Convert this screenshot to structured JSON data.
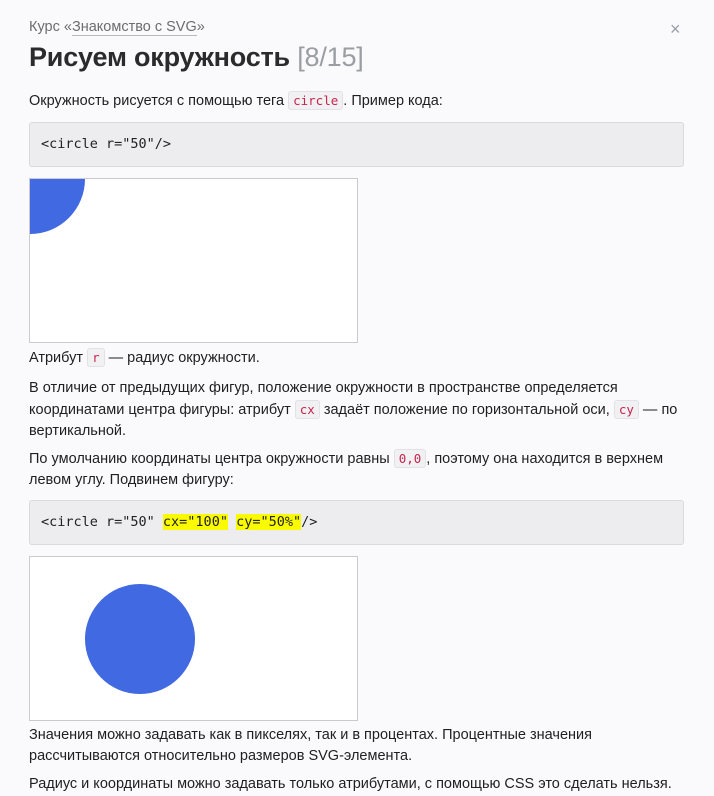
{
  "breadcrumb": {
    "prefix": "Курс «",
    "course_link": "Знакомство с SVG",
    "suffix": "»"
  },
  "close_label": "×",
  "title": {
    "text": "Рисуем окружность",
    "counter": "[8/15]"
  },
  "intro": {
    "before": "Окружность рисуется с помощью тега ",
    "tag": "circle",
    "after": ". Пример кода:"
  },
  "code1": "<circle r=\"50\"/>",
  "attr_r": {
    "before": "Атрибут ",
    "code": "r",
    "after": " — радиус окружности."
  },
  "position_para": {
    "part1": "В отличие от предыдущих фигур, положение окружности в пространстве определяется координатами центра фигуры: атрибут ",
    "code_cx": "cx",
    "part2": " задаёт положение по горизонтальной оси, ",
    "code_cy": "cy",
    "part3": " — по вертикальной."
  },
  "default_para": {
    "before": "По умолчанию координаты центра окружности равны ",
    "code": "0,0",
    "after": ", поэтому она находится в верхнем левом углу. Подвинем фигуру:"
  },
  "code2": {
    "start": "<circle r=\"50\" ",
    "cx": "cx=\"100\"",
    "space": " ",
    "cy": "cy=\"50%\"",
    "end": "/>"
  },
  "values_para": "Значения можно задавать как в пикселях, так и в процентах. Процентные значения рассчитываются относительно размеров SVG-элемента.",
  "last_para": "Радиус и координаты можно задавать только атрибутами, с помощью CSS это сделать нельзя.",
  "colors": {
    "circle_fill": "#4169e1",
    "highlight": "#fbfb00",
    "code_text": "#c7254e"
  }
}
